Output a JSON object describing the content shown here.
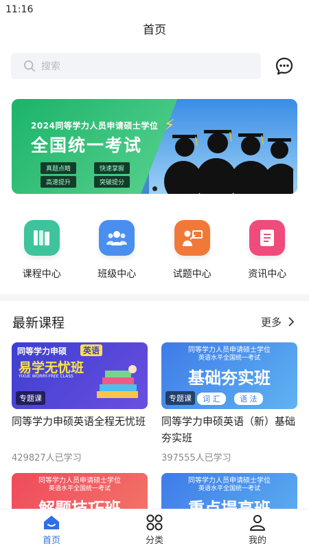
{
  "status_bar": {
    "time": "11:16"
  },
  "header": {
    "title": "首页"
  },
  "search": {
    "placeholder": "搜索"
  },
  "banner": {
    "line1": "2024同等学力人员申请硕士学位",
    "line2": "全国统一考试",
    "tags": [
      "真题点睛",
      "快速掌握",
      "高速提升",
      "突破提分"
    ]
  },
  "quick_nav": [
    {
      "label": "课程中心",
      "icon": "books-icon",
      "color": "#3ec39d"
    },
    {
      "label": "班级中心",
      "icon": "group-icon",
      "color": "#4a8ff0"
    },
    {
      "label": "试题中心",
      "icon": "teacher-icon",
      "color": "#f0793a"
    },
    {
      "label": "资讯中心",
      "icon": "news-icon",
      "color": "#ef4c7b"
    }
  ],
  "section": {
    "title": "最新课程",
    "more": "更多"
  },
  "courses": [
    {
      "name": "同等学力申硕英语全程无忧班",
      "students": "429827人已学习",
      "thumb_title": "同等学力申硕",
      "thumb_subject": "英语",
      "thumb_big": "易学无忧班",
      "thumb_en": "YIXUE WORRY-FREE CLASS",
      "tag": "专题课"
    },
    {
      "name": "同等学力申硕英语（新）基础夯实班",
      "students": "397555人已学习",
      "thumb_title": "同等学力人员申请硕士学位",
      "thumb_sub": "英语水平全国统一考试",
      "thumb_big": "基础夯实班",
      "thumb_chips": [
        "词 汇",
        "语 法"
      ],
      "tag": "专题课"
    },
    {
      "thumb_title": "同等学力人员申请硕士学位",
      "thumb_sub": "英语水平全国统一考试",
      "thumb_big": "解题技巧班"
    },
    {
      "thumb_title": "同等学力人员申请硕士学位",
      "thumb_sub": "英语水平全国统一考试",
      "thumb_big": "重点提高班"
    }
  ],
  "tabbar": [
    {
      "label": "首页",
      "icon": "home-icon",
      "active": true
    },
    {
      "label": "分类",
      "icon": "category-icon",
      "active": false
    },
    {
      "label": "我的",
      "icon": "user-icon",
      "active": false
    }
  ],
  "colors": {
    "accent": "#2e6fe8",
    "banner_green": "#1bb36a"
  }
}
